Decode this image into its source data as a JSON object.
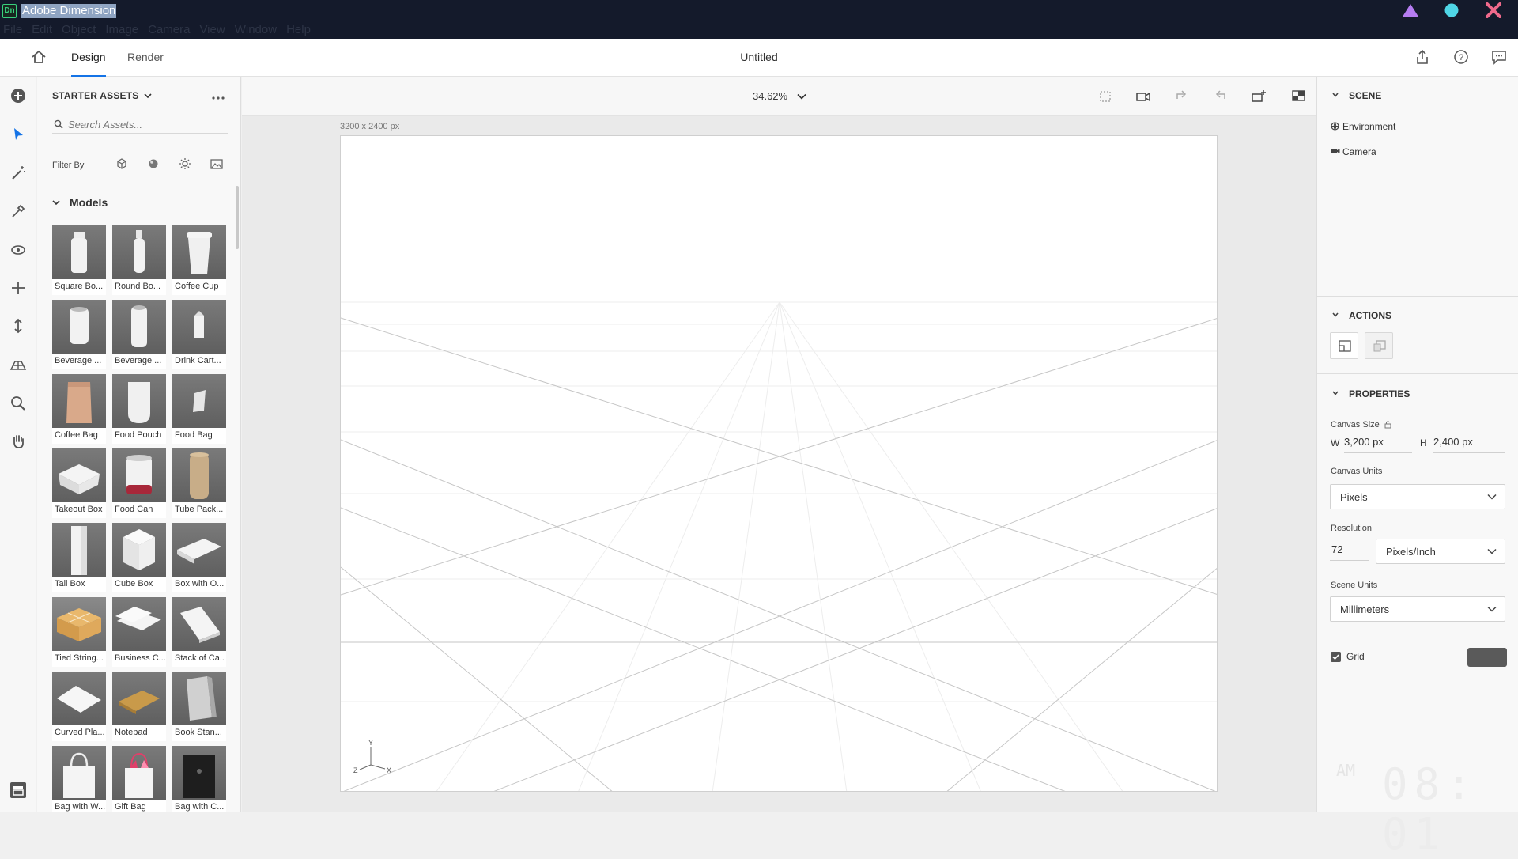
{
  "window": {
    "app_badge": "Dn",
    "title": "Adobe Dimension",
    "menu": [
      "File",
      "Edit",
      "Object",
      "Image",
      "Camera",
      "View",
      "Window",
      "Help"
    ]
  },
  "header": {
    "tabs": [
      {
        "label": "Design",
        "active": true
      },
      {
        "label": "Render",
        "active": false
      }
    ],
    "document_title": "Untitled"
  },
  "assets_panel": {
    "title": "STARTER ASSETS",
    "search_placeholder": "Search Assets...",
    "filter_label": "Filter By",
    "section": "Models",
    "models": [
      "Square Bo...",
      "Round Bo...",
      "Coffee Cup",
      "Beverage ...",
      "Beverage ...",
      "Drink Cart...",
      "Coffee Bag",
      "Food Pouch",
      "Food Bag",
      "Takeout Box",
      "Food Can",
      "Tube Pack...",
      "Tall Box",
      "Cube Box",
      "Box with O...",
      "Tied String...",
      "Business C...",
      "Stack of Ca...",
      "Curved Pla...",
      "Notepad",
      "Book Stan...",
      "Bag with W...",
      "Gift Bag",
      "Bag with C..."
    ]
  },
  "viewport": {
    "zoom": "34.62%",
    "canvas_size_label": "3200 x 2400 px",
    "axis_labels": {
      "y": "Y",
      "z": "Z",
      "x": "X"
    }
  },
  "right_panel": {
    "scene": {
      "title": "SCENE",
      "items": [
        "Environment",
        "Camera"
      ]
    },
    "actions": {
      "title": "ACTIONS"
    },
    "properties": {
      "title": "PROPERTIES",
      "canvas_size_label": "Canvas Size",
      "width_prefix": "W",
      "width_value": "3,200 px",
      "height_prefix": "H",
      "height_value": "2,400 px",
      "canvas_units_label": "Canvas Units",
      "canvas_units_value": "Pixels",
      "resolution_label": "Resolution",
      "resolution_value": "72",
      "resolution_unit": "Pixels/Inch",
      "scene_units_label": "Scene Units",
      "scene_units_value": "Millimeters",
      "grid_label": "Grid",
      "grid_checked": true
    }
  },
  "overlay_clock": {
    "ampm": "AM",
    "time": "08: 01"
  },
  "colors": {
    "accent": "#1473e6",
    "titlebar": "#141a2b",
    "app_badge_green": "#38d07e",
    "window_triangle": "#b57cf0",
    "window_circle": "#4fd6e6",
    "window_close": "#f06a8c"
  }
}
